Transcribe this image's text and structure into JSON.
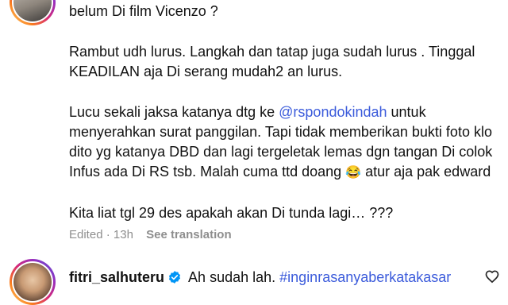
{
  "comment": {
    "line1": "belum Di film Vicenzo ?",
    "para2": "Rambut udh lurus. Langkah dan tatap juga sudah lurus . Tinggal KEADILAN aja Di serang mudah2 an lurus.",
    "para3_before": "Lucu sekali jaksa katanya dtg ke ",
    "para3_mention": "@rspondokindah",
    "para3_after": " untuk menyerahkan surat panggilan. Tapi tidak memberikan bukti foto klo dito yg katanya DBD dan lagi tergeletak lemas dgn tangan Di colok Infus ada Di RS tsb. Malah cuma ttd doang ",
    "para3_emoji": "😂",
    "para3_end": " atur aja pak edward",
    "para4": "Kita liat tgl 29 des apakah akan Di tunda lagi… ???"
  },
  "meta": {
    "edited": "Edited",
    "separator": "·",
    "time": "13h",
    "see_translation": "See translation"
  },
  "reply": {
    "username": "fitri_salhuteru",
    "text": "Ah sudah lah.",
    "hashtag": "#inginrasanyaberkatakasar"
  },
  "icons": {
    "like": "heart-icon",
    "verified": "verified-badge-icon"
  },
  "colors": {
    "link": "#3b5bdb",
    "muted": "#8e8e8e",
    "verified": "#0095f6"
  }
}
